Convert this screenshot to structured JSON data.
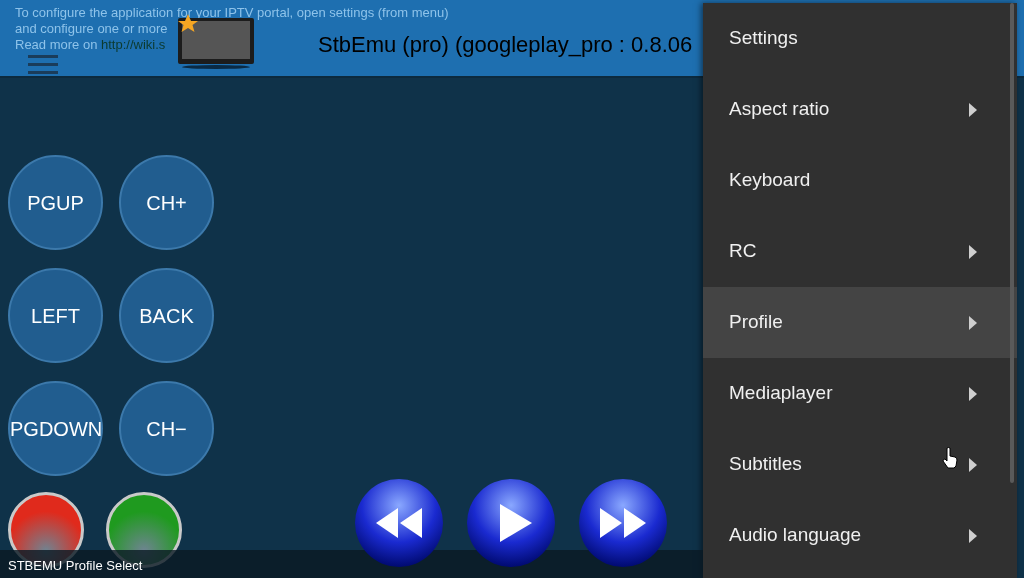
{
  "header": {
    "info_lines": [
      "To configure the application for your IPTV portal, open settings (from menu)",
      "and configure one or more"
    ],
    "read_more": "Read more on",
    "link": "http://wiki.s",
    "title": "StbEmu (pro) (googleplay_pro : 0.8.06"
  },
  "keys": [
    {
      "label": "PGUP"
    },
    {
      "label": "CH+"
    },
    {
      "label": "LEFT"
    },
    {
      "label": "BACK"
    },
    {
      "label": "PGDOWN"
    },
    {
      "label": "CH−"
    }
  ],
  "color_buttons": [
    {
      "color": "#e02a1c"
    },
    {
      "color": "#1f9a1f"
    }
  ],
  "media_buttons": [
    {
      "kind": "rewind"
    },
    {
      "kind": "play"
    },
    {
      "kind": "forward"
    }
  ],
  "status_bar": "STBEMU Profile Select",
  "menu": [
    {
      "label": "Settings",
      "submenu": false,
      "selected": false
    },
    {
      "label": "Aspect ratio",
      "submenu": true,
      "selected": false
    },
    {
      "label": "Keyboard",
      "submenu": false,
      "selected": false
    },
    {
      "label": "RC",
      "submenu": true,
      "selected": false
    },
    {
      "label": "Profile",
      "submenu": true,
      "selected": true
    },
    {
      "label": "Mediaplayer",
      "submenu": true,
      "selected": false
    },
    {
      "label": "Subtitles",
      "submenu": true,
      "selected": false
    },
    {
      "label": "Audio language",
      "submenu": true,
      "selected": false
    }
  ]
}
